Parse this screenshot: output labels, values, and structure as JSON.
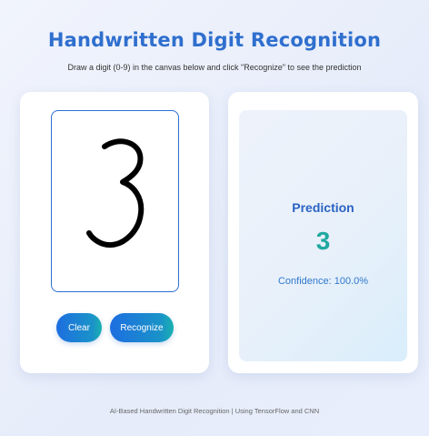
{
  "header": {
    "title": "Handwritten Digit Recognition",
    "subtitle": "Draw a digit (0-9) in the canvas below and click \"Recognize\" to see the prediction"
  },
  "canvas": {
    "drawn_digit": "3",
    "stroke_color": "#000000",
    "border_color": "#2d6fd4"
  },
  "buttons": {
    "clear_label": "Clear",
    "recognize_label": "Recognize"
  },
  "prediction": {
    "label": "Prediction",
    "digit": "3",
    "confidence": "Confidence: 100.0%"
  },
  "footer": {
    "text": "AI-Based Handwritten Digit Recognition | Using TensorFlow and CNN"
  },
  "colors": {
    "title": "#2f6fce",
    "accent_teal": "#20a8a0",
    "button_gradient_start": "#1d6ee0",
    "button_gradient_end": "#1ab1b0"
  }
}
